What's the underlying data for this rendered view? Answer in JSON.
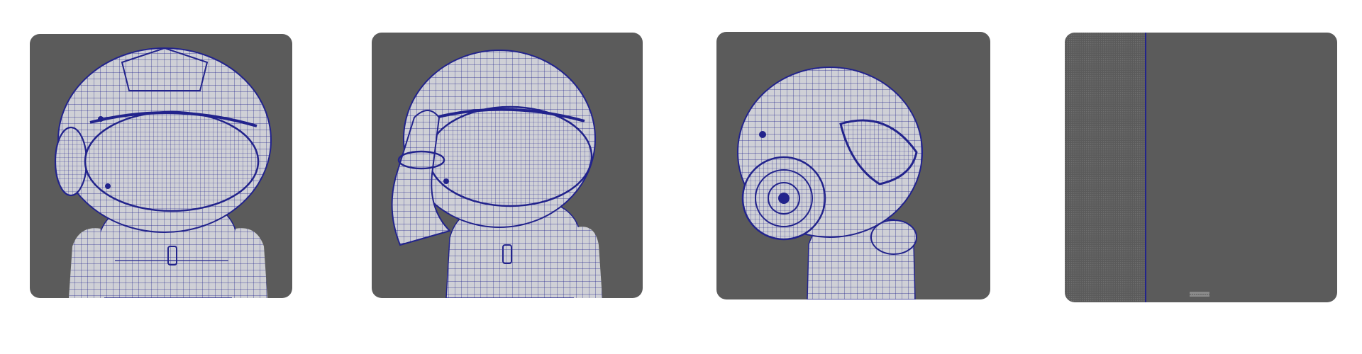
{
  "viewports": [
    {
      "view": "front-three-quarter"
    },
    {
      "view": "salute-pose"
    },
    {
      "view": "side-profile"
    },
    {
      "view": "uv-layout"
    }
  ],
  "colors": {
    "page_background": "#ffffff",
    "viewport_background": "#5b5b5b",
    "mesh_surface": "#cfd0d6",
    "wireframe": "#22238c"
  }
}
